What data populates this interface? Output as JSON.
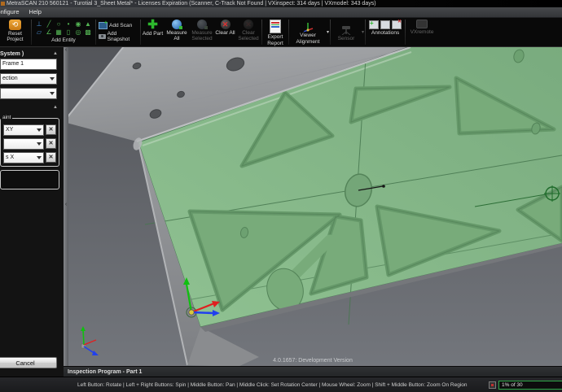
{
  "title_bar": {
    "title": "MetraSCAN 210 560121 - Turotial 3_Sheet Metal* - Licenses Expiration (Scanner, C-Track Not Found | VXinspect: 314 days | VXmodel: 343 days)"
  },
  "menu_bar": {
    "items": [
      {
        "label": "Configure"
      },
      {
        "label": "Help"
      }
    ]
  },
  "toolbar": {
    "reset_project": {
      "label": "Reset Project"
    },
    "add_entity": {
      "label": "Add Entity",
      "icons": [
        "coordinate-system",
        "line",
        "circle",
        "point",
        "ellipse",
        "cone",
        "plane",
        "angle",
        "grid",
        "cylinder",
        "torus",
        "mesh"
      ]
    },
    "add_scan": {
      "label": "Add Scan"
    },
    "add_snapshot": {
      "label": "Add Snapshot"
    },
    "add_part": {
      "label": "Add Part"
    },
    "measure_all": {
      "label": "Measure All"
    },
    "measure_selected": {
      "label": "Measure Selected",
      "disabled": true
    },
    "clear_all": {
      "label": "Clear All"
    },
    "clear_selected": {
      "label": "Clear Selected",
      "disabled": true
    },
    "export_report": {
      "label": "Export Report"
    },
    "viewer_alignment": {
      "label": "Viewer Alignment"
    },
    "sensor": {
      "label": "Sensor",
      "disabled": true
    },
    "annotations": {
      "label": "Annotations"
    },
    "vxremote": {
      "label": "VXremote",
      "disabled": true
    }
  },
  "left_panel": {
    "coordinate_section": {
      "header_fragment": "System )",
      "name_field_value": "Frame 1",
      "dropdown1_fragment": "ection",
      "dropdown2_fragment": ""
    },
    "constraint_section": {
      "group_label_fragment": "aint",
      "rows": [
        {
          "value_fragment": "XY"
        },
        {
          "value_fragment": ""
        },
        {
          "value_fragment": "s X"
        }
      ]
    },
    "cancel_button": "Cancel"
  },
  "viewport": {
    "version_text": "4.0.1657: Development Version"
  },
  "tab_bar": {
    "active_tab": "Inspection Program - Part 1"
  },
  "status_bar": {
    "hints": "Left Button: Rotate  |  Left + Right Buttons: Spin  |  Middle Button: Pan  |  Middle Click: Set Rotation Center  |  Mouse Wheel: Zoom  |  Shift + Middle Button: Zoom On Region",
    "memory_usage": "1% of 30"
  },
  "colors": {
    "part_face_green": "#87BA89",
    "pocket_green": "#77AA79",
    "flange_gray": "#9A9C9F",
    "viewport_background": "#63666C",
    "usage_border_green": "#2FA848",
    "axis_x_red": "#E02020",
    "axis_y_green": "#10C010",
    "axis_z_blue": "#2040EE"
  }
}
